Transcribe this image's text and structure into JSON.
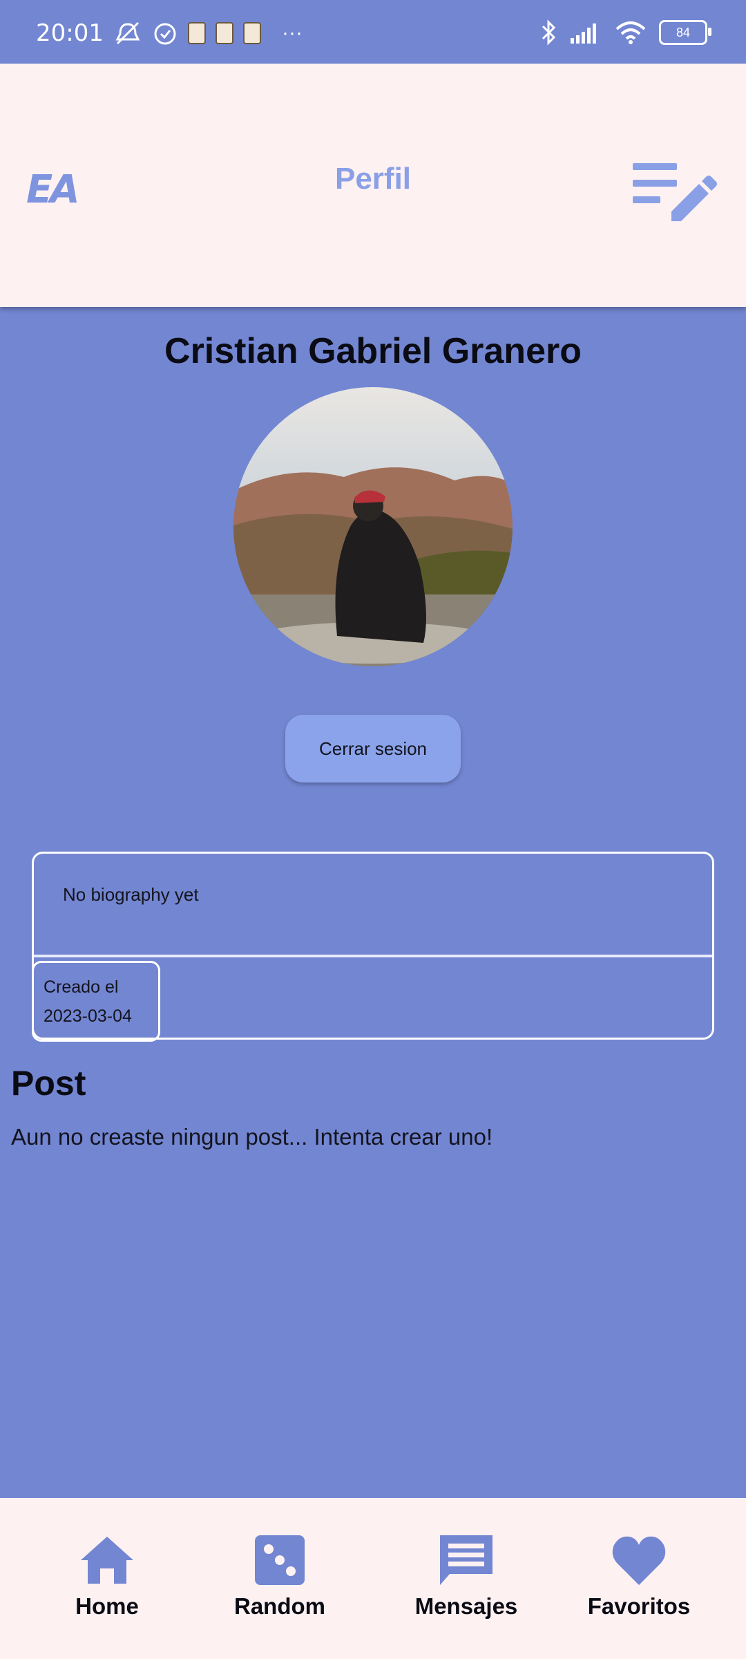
{
  "status_bar": {
    "time": "20:01",
    "dots": "···",
    "battery": "84"
  },
  "header": {
    "logo": "EA",
    "title": "Perfil"
  },
  "profile": {
    "name": "Cristian Gabriel Granero",
    "logout_label": "Cerrar sesion",
    "bio": "No biography yet",
    "created_label": "Creado el",
    "created_date": "2023-03-04"
  },
  "posts": {
    "heading": "Post",
    "empty_message": "Aun no creaste ningun post... Intenta crear uno!"
  },
  "nav": {
    "items": [
      {
        "label": "Home",
        "icon": "home-icon"
      },
      {
        "label": "Random",
        "icon": "dice-icon"
      },
      {
        "label": "Mensajes",
        "icon": "message-icon"
      },
      {
        "label": "Favoritos",
        "icon": "heart-icon"
      }
    ]
  },
  "colors": {
    "background": "#7386d2",
    "surface": "#fdf1f2",
    "accent": "#8aa0e6",
    "nav_icon": "#7386d2"
  }
}
